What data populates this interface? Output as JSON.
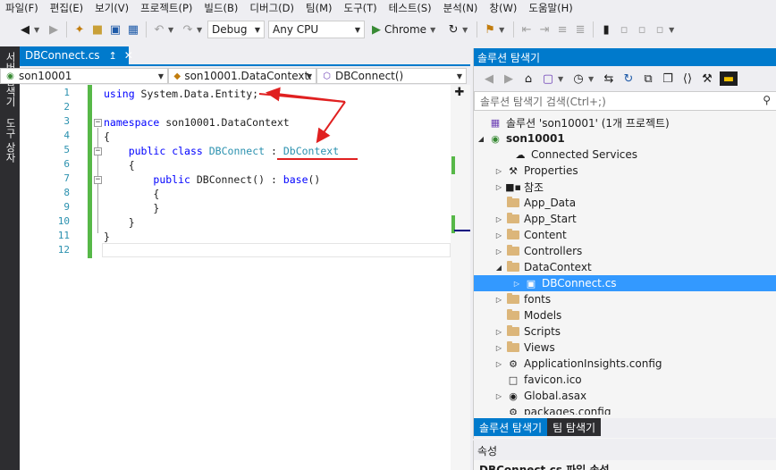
{
  "menu": [
    "파일(F)",
    "편집(E)",
    "보기(V)",
    "프로젝트(P)",
    "빌드(B)",
    "디버그(D)",
    "팀(M)",
    "도구(T)",
    "테스트(S)",
    "분석(N)",
    "창(W)",
    "도움말(H)"
  ],
  "toolbar": {
    "config": "Debug",
    "platform": "Any CPU",
    "run_label": "Chrome"
  },
  "side_strip": [
    "서버 탐색기",
    "도구 상자"
  ],
  "editor": {
    "tab_label": "DBConnect.cs",
    "nav_project": "son10001",
    "nav_class": "son10001.DataContext.",
    "nav_member": "DBConnect()",
    "lines": [
      {
        "num": "1",
        "text": "using System.Data.Entity;"
      },
      {
        "num": "2",
        "text": ""
      },
      {
        "num": "3",
        "text": "namespace son10001.DataContext"
      },
      {
        "num": "4",
        "text": "{"
      },
      {
        "num": "5",
        "text": "    public class DBConnect : DbContext"
      },
      {
        "num": "6",
        "text": "    {"
      },
      {
        "num": "7",
        "text": "        public DBConnect() : base()"
      },
      {
        "num": "8",
        "text": "        {"
      },
      {
        "num": "9",
        "text": "        }"
      },
      {
        "num": "10",
        "text": "    }"
      },
      {
        "num": "11",
        "text": "}"
      },
      {
        "num": "12",
        "text": ""
      }
    ],
    "tokens": {
      "using": "using",
      "using_rest": " System.Data.Entity;",
      "namespace": "namespace",
      "namespace_rest": " son10001.DataContext",
      "public": "public",
      "class": "class",
      "DBConnect": "DBConnect",
      "colon": " : ",
      "DbContext": "DbContext",
      "ctor_rest": " DBConnect() : ",
      "base": "base",
      "base_paren": "()"
    }
  },
  "solution_explorer": {
    "title": "솔루션 탐색기",
    "search_placeholder": "솔루션 탐색기 검색(Ctrl+;)",
    "items": [
      {
        "label": "솔루션 'son10001' (1개 프로젝트)",
        "icon": "solution-icon"
      },
      {
        "label": "son10001",
        "icon": "web-project-icon"
      },
      {
        "label": "Connected Services",
        "icon": "cloud-icon"
      },
      {
        "label": "Properties",
        "icon": "wrench-icon"
      },
      {
        "label": "참조",
        "icon": "references-icon"
      },
      {
        "label": "App_Data",
        "icon": "folder-icon"
      },
      {
        "label": "App_Start",
        "icon": "folder-icon"
      },
      {
        "label": "Content",
        "icon": "folder-icon"
      },
      {
        "label": "Controllers",
        "icon": "folder-icon"
      },
      {
        "label": "DataContext",
        "icon": "folder-open-icon"
      },
      {
        "label": "DBConnect.cs",
        "icon": "csharp-file-icon"
      },
      {
        "label": "fonts",
        "icon": "folder-icon"
      },
      {
        "label": "Models",
        "icon": "folder-icon"
      },
      {
        "label": "Scripts",
        "icon": "folder-icon"
      },
      {
        "label": "Views",
        "icon": "folder-icon"
      },
      {
        "label": "ApplicationInsights.config",
        "icon": "config-file-icon"
      },
      {
        "label": "favicon.ico",
        "icon": "file-icon"
      },
      {
        "label": "Global.asax",
        "icon": "asax-file-icon"
      },
      {
        "label": "packages.config",
        "icon": "config-file-icon"
      }
    ],
    "tab_solution": "솔루션 탐색기",
    "tab_team": "팀 탐색기"
  },
  "properties": {
    "title": "속성",
    "subtitle": "DBConnect.cs 파일 속성"
  },
  "colors": {
    "accent": "#007acc",
    "selection": "#3399ff",
    "keyword": "#0000ff",
    "type": "#2b91af",
    "change_bar": "#57b848",
    "annotation": "#e02020"
  }
}
